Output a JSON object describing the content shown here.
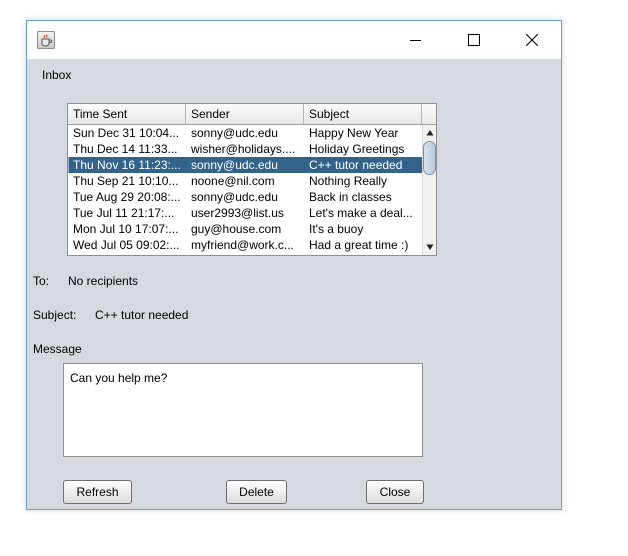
{
  "window": {
    "title": "",
    "icons": {
      "app": "java-cup-icon",
      "minimize": "minimize-icon",
      "maximize": "maximize-icon",
      "close": "close-icon"
    }
  },
  "inbox_label": "Inbox",
  "table": {
    "columns": [
      "Time Sent",
      "Sender",
      "Subject"
    ],
    "selected_index": 2,
    "rows": [
      {
        "time": "Sun Dec 31 10:04...",
        "sender": "sonny@udc.edu",
        "subject": "Happy New Year"
      },
      {
        "time": "Thu Dec 14 11:33...",
        "sender": "wisher@holidays....",
        "subject": "Holiday Greetings"
      },
      {
        "time": "Thu Nov 16 11:23:...",
        "sender": "sonny@udc.edu",
        "subject": "C++ tutor needed"
      },
      {
        "time": "Thu Sep 21 10:10...",
        "sender": "noone@nil.com",
        "subject": "Nothing Really"
      },
      {
        "time": "Tue Aug 29 20:08:...",
        "sender": "sonny@udc.edu",
        "subject": "Back in classes"
      },
      {
        "time": "Tue Jul 11 21:17:...",
        "sender": "user2993@list.us",
        "subject": "Let's make a deal..."
      },
      {
        "time": "Mon Jul 10 17:07:...",
        "sender": "guy@house.com",
        "subject": "It's a buoy"
      },
      {
        "time": "Wed Jul 05 09:02:...",
        "sender": "myfriend@work.c...",
        "subject": "Had a great time :)"
      }
    ]
  },
  "to": {
    "label": "To:",
    "value": "No recipients"
  },
  "subject": {
    "label": "Subject:",
    "value": "C++ tutor needed"
  },
  "message": {
    "label": "Message",
    "body": "Can you help me?"
  },
  "buttons": {
    "refresh": "Refresh",
    "delete": "Delete",
    "close": "Close"
  },
  "colors": {
    "selection": "#33628a",
    "window_bg": "#d6d9df",
    "border_accent": "#6ca0d0"
  }
}
